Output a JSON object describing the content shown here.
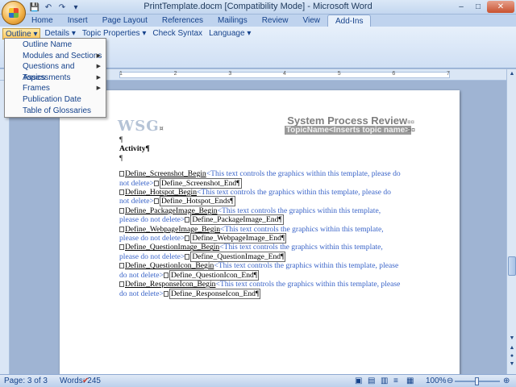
{
  "window": {
    "title": "PrintTemplate.docm [Compatibility Mode] - Microsoft Word",
    "minimize": "–",
    "maximize": "□",
    "close": "✕"
  },
  "qat": {
    "save": "💾",
    "undo": "↶",
    "redo": "↷",
    "more": "▾"
  },
  "tabs": [
    "Home",
    "Insert",
    "Page Layout",
    "References",
    "Mailings",
    "Review",
    "View",
    "Add-Ins"
  ],
  "addins": {
    "menus": [
      "Outline ▾",
      "Details ▾",
      "Topic Properties ▾",
      "Check Syntax",
      "Language ▾"
    ],
    "group_label": "ars"
  },
  "dropdown": {
    "items": [
      {
        "label": "Outline Name",
        "arrow": ""
      },
      {
        "label": "Modules and Sections",
        "arrow": "▶"
      },
      {
        "label": "Questions and Assessments",
        "arrow": "▶"
      },
      {
        "label": "Topics",
        "arrow": "▶"
      },
      {
        "label": "Frames",
        "arrow": "▶"
      },
      {
        "label": "Publication Date",
        "arrow": ""
      },
      {
        "label": "Table of Glossaries",
        "arrow": ""
      }
    ]
  },
  "ruler": {
    "nums": [
      "1",
      "2",
      "3",
      "4",
      "5",
      "6",
      "7"
    ]
  },
  "document": {
    "logo": "WSG",
    "logo_mark": "¤",
    "header_title": "System Process Review",
    "header_title_mark": "¤¤",
    "topic_name": "TopicName<Inserts topic name>",
    "topic_marks": "¤¤",
    "pilcrow1": "¶",
    "activity": "Activity¶",
    "pilcrow2": "¶",
    "lines": [
      {
        "begin": "Define_Screenshot_Begin",
        "text": "<This text controls the graphics within this template, please do not delete>",
        "end": "Define_Screenshot_End¶"
      },
      {
        "begin": "Define_Hotspot_Begin",
        "text": "<This text controls the graphics within this template, please do not delete>",
        "end": "Define_Hotspot_Ends¶"
      },
      {
        "begin": "Define_PackageImage_Begin",
        "text": "<This text controls the graphics within this template, please do not delete>",
        "end": "Define_PackageImage_End¶"
      },
      {
        "begin": "Define_WebpageImage_Begin",
        "text": "<This text controls the graphics within this template, please do not delete>",
        "end": "Define_WebpageImage_End¶"
      },
      {
        "begin": "Define_QuestionImage_Begin",
        "text": "<This text controls the graphics within this template, please do not delete>",
        "end": "Define_QuestionImage_End¶"
      },
      {
        "begin": "Define_QuestionIcon_Begin",
        "text": "<This text controls the graphics within this template, please do not delete>",
        "end": "Define_QuestionIcon_End¶"
      },
      {
        "begin": "Define_ResponseIcon_Begin",
        "text": "<This text controls the graphics within this template, please do not delete>",
        "end": "Define_ResponseIcon_End¶"
      }
    ]
  },
  "status": {
    "page": "Page: 3 of 3",
    "words": "Words: 245",
    "zoom": "100%",
    "zoom_level": 0.5
  },
  "colors": {
    "accent": "#15428b",
    "field_text": "#3a64c8",
    "menu_open": "#ffc95e"
  }
}
